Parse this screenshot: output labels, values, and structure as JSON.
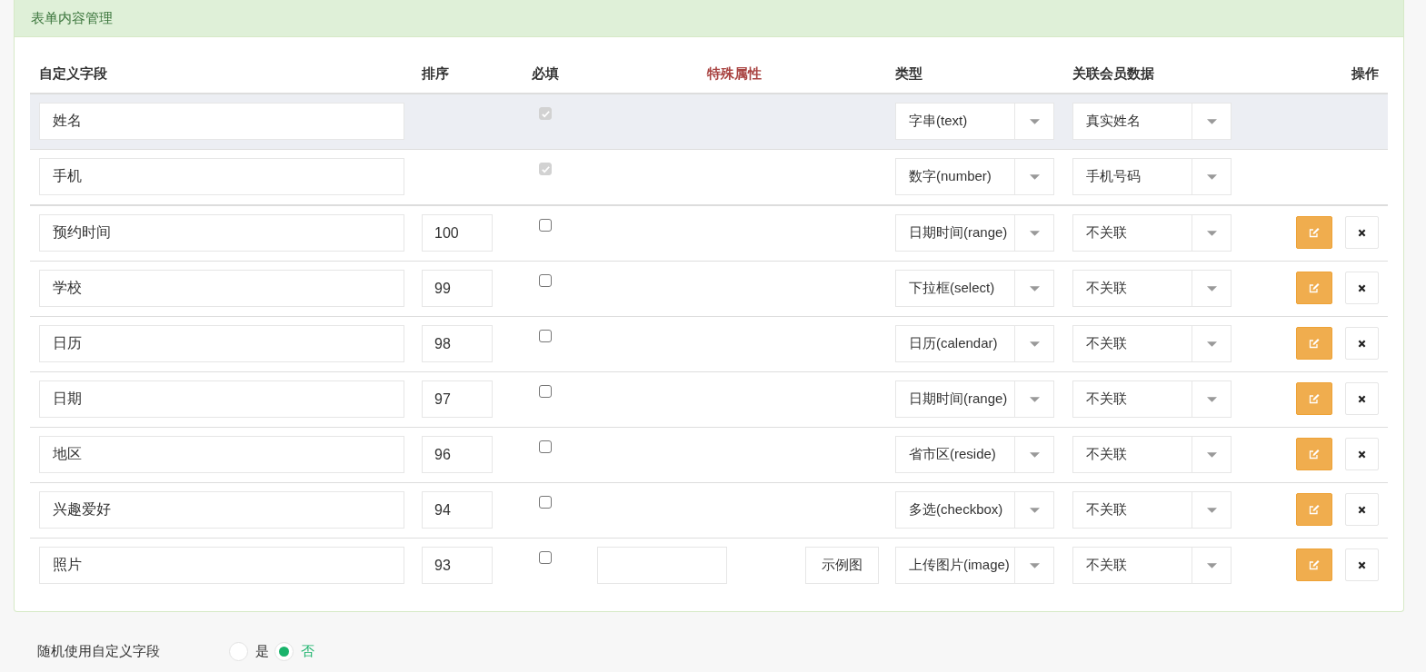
{
  "panel": {
    "title": "表单内容管理"
  },
  "table": {
    "columns": [
      "自定义字段",
      "排序",
      "必填",
      "特殊属性",
      "类型",
      "关联会员数据",
      "操作"
    ],
    "rows": [
      {
        "kind": "fixed",
        "selected": true,
        "name": "姓名",
        "required": {
          "checked": true,
          "disabled": true
        },
        "type": "字串(text)",
        "relation": "真实姓名"
      },
      {
        "kind": "fixed",
        "selected": false,
        "name": "手机",
        "required": {
          "checked": true,
          "disabled": true
        },
        "type": "数字(number)",
        "relation": "手机号码"
      },
      {
        "kind": "custom",
        "selected": false,
        "name": "预约时间",
        "order": "100",
        "required": {
          "checked": false,
          "disabled": false
        },
        "type": "日期时间(range)",
        "relation": "不关联"
      },
      {
        "kind": "custom",
        "selected": false,
        "name": "学校",
        "order": "99",
        "required": {
          "checked": false,
          "disabled": false
        },
        "type": "下拉框(select)",
        "relation": "不关联"
      },
      {
        "kind": "custom",
        "selected": false,
        "name": "日历",
        "order": "98",
        "required": {
          "checked": false,
          "disabled": false
        },
        "type": "日历(calendar)",
        "relation": "不关联"
      },
      {
        "kind": "custom",
        "selected": false,
        "name": "日期",
        "order": "97",
        "required": {
          "checked": false,
          "disabled": false
        },
        "type": "日期时间(range)",
        "relation": "不关联"
      },
      {
        "kind": "custom",
        "selected": false,
        "name": "地区",
        "order": "96",
        "required": {
          "checked": false,
          "disabled": false
        },
        "type": "省市区(reside)",
        "relation": "不关联"
      },
      {
        "kind": "custom",
        "selected": false,
        "name": "兴趣爱好",
        "order": "94",
        "required": {
          "checked": false,
          "disabled": false
        },
        "type": "多选(checkbox)",
        "relation": "不关联"
      },
      {
        "kind": "custom",
        "selected": false,
        "name": "照片",
        "order": "93",
        "required": {
          "checked": false,
          "disabled": false
        },
        "special": {
          "button": "示例图"
        },
        "type": "上传图片(image)",
        "relation": "不关联"
      }
    ]
  },
  "random_fields": {
    "label": "随机使用自定义字段",
    "options": [
      {
        "label": "是",
        "selected": false
      },
      {
        "label": "否",
        "selected": true
      }
    ]
  }
}
